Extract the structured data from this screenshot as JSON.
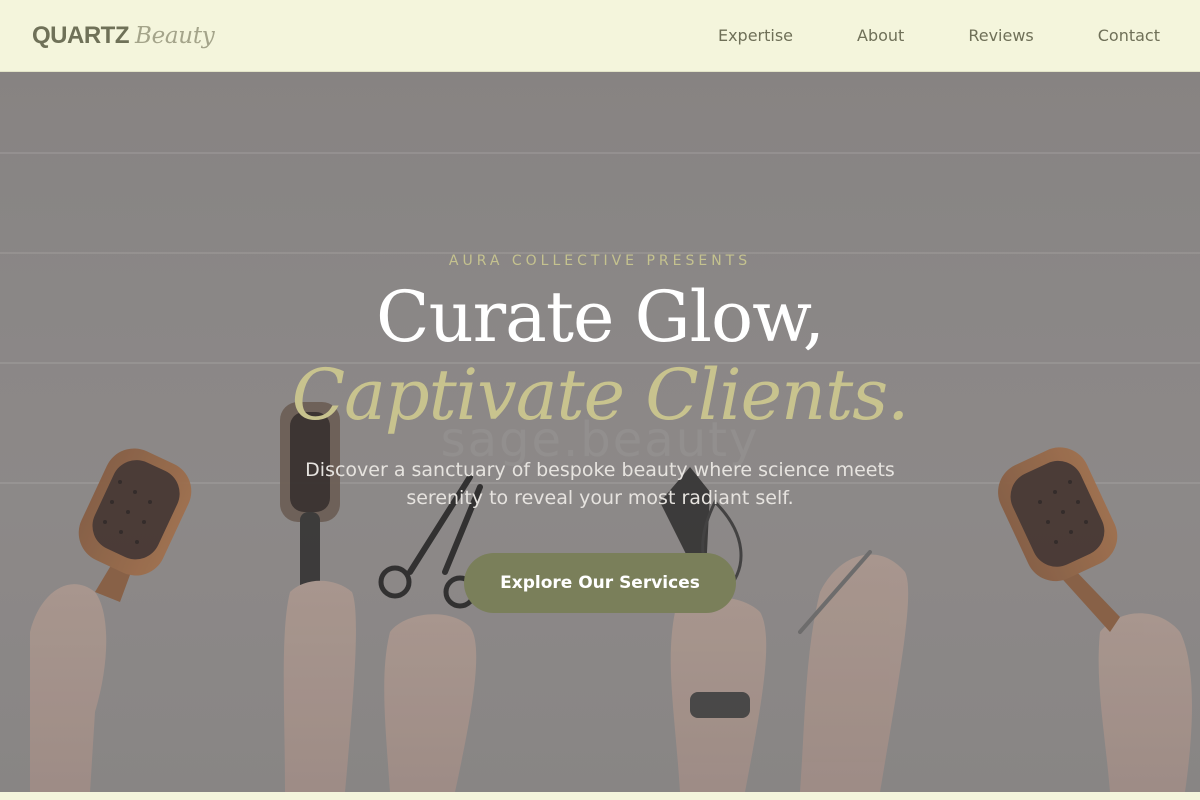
{
  "brand": {
    "name_bold": "QUARTZ",
    "name_italic": "Beauty"
  },
  "nav": {
    "items": [
      {
        "label": "Expertise"
      },
      {
        "label": "About"
      },
      {
        "label": "Reviews"
      },
      {
        "label": "Contact"
      }
    ]
  },
  "hero": {
    "eyebrow": "AURA COLLECTIVE PRESENTS",
    "headline_line1": "Curate Glow,",
    "headline_line2": "Captivate Clients.",
    "subtext": "Discover a sanctuary of bespoke beauty where science meets serenity to reveal your most radiant self.",
    "cta_label": "Explore Our Services",
    "background_image_watermark": "sage.beauty",
    "background_image_description_icon": "hands-holding-hair-tools-photo"
  },
  "colors": {
    "header_bg": "#f4f5dc",
    "logo_text": "#6f7158",
    "accent_gold": "#c8c38e",
    "cta_bg": "#7a7f5a"
  }
}
